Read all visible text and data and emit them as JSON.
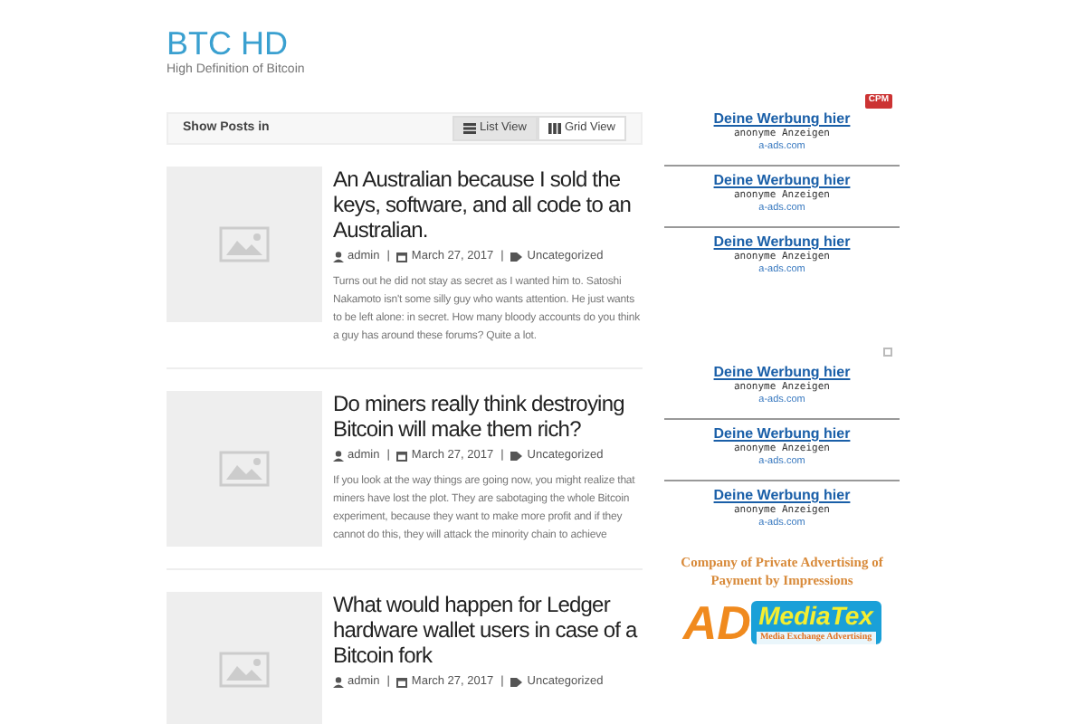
{
  "site": {
    "title": "BTC HD",
    "tagline": "High Definition of Bitcoin"
  },
  "toolbar": {
    "label": "Show Posts in",
    "views": [
      {
        "label": "List View",
        "kind": "list",
        "selected": true
      },
      {
        "label": "Grid View",
        "kind": "grid",
        "selected": false
      }
    ]
  },
  "posts": [
    {
      "title": "An Australian because I sold the keys, software, and all code to an Australian.",
      "author": "admin",
      "separators": [
        "|",
        "|"
      ],
      "date": "March 27, 2017",
      "category": "Uncategorized",
      "excerpt": "Turns out he did not stay as secret as I wanted him to. Satoshi Nakamoto isn't some silly guy who wants attention. He just wants to be left alone: in secret. How many bloody accounts do you think a guy has around these forums? Quite a lot."
    },
    {
      "title": "Do miners really think destroying Bitcoin will make them rich?",
      "author": "admin",
      "separators": [
        "|",
        "|"
      ],
      "date": "March 27, 2017",
      "category": "Uncategorized",
      "excerpt": "If you look at the way things are going now, you might realize that miners have lost the plot. They are sabotaging the whole Bitcoin experiment, because they want to make more profit and if they cannot do this, they will attack the minority chain to achieve"
    },
    {
      "title": "What would happen for Ledger hardware wallet users in case of a Bitcoin fork",
      "author": "admin",
      "separators": [
        "|",
        "|"
      ],
      "date": "March 27, 2017",
      "category": "Uncategorized"
    }
  ],
  "ad_groups": [
    {
      "badge": "CPM",
      "ads": [
        {
          "headline": "Deine Werbung hier",
          "subtitle": "anonyme Anzeigen",
          "domain": "a-ads.com"
        },
        {
          "headline": "Deine Werbung hier",
          "subtitle": "anonyme Anzeigen",
          "domain": "a-ads.com"
        },
        {
          "headline": "Deine Werbung hier",
          "subtitle": "anonyme Anzeigen",
          "domain": "a-ads.com"
        }
      ]
    },
    {
      "ads": [
        {
          "headline": "Deine Werbung hier",
          "subtitle": "anonyme Anzeigen",
          "domain": "a-ads.com"
        },
        {
          "headline": "Deine Werbung hier",
          "subtitle": "anonyme Anzeigen",
          "domain": "a-ads.com"
        },
        {
          "headline": "Deine Werbung hier",
          "subtitle": "anonyme Anzeigen",
          "domain": "a-ads.com"
        }
      ]
    }
  ],
  "banner": {
    "heading": "Company of Private Advertising of Payment by Impressions",
    "logo_ad": "AD",
    "logo_name": "MediaTex",
    "logo_tagline": "Media Exchange Advertising"
  }
}
